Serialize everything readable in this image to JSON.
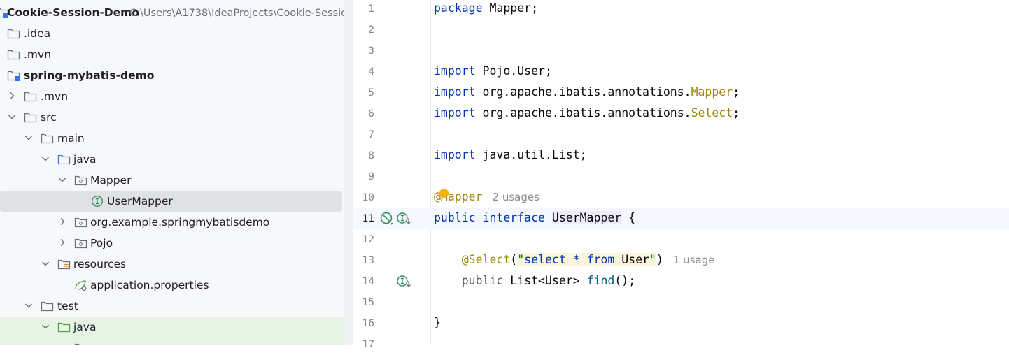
{
  "project_tree": {
    "root": {
      "name": "Cookie-Session-Demo",
      "path": "C:\\Users\\A1738\\IdeaProjects\\Cookie-Sessio"
    },
    "items": [
      {
        "label": "Cookie-Session-Demo",
        "icon": "module-folder-icon"
      },
      {
        "label": ".idea",
        "icon": "folder-icon"
      },
      {
        "label": ".mvn",
        "icon": "folder-icon"
      },
      {
        "label": "spring-mybatis-demo",
        "icon": "module-folder-icon"
      },
      {
        "label": ".mvn",
        "icon": "folder-icon"
      },
      {
        "label": "src",
        "icon": "folder-icon"
      },
      {
        "label": "main",
        "icon": "folder-icon"
      },
      {
        "label": "java",
        "icon": "source-folder-icon"
      },
      {
        "label": "Mapper",
        "icon": "package-icon"
      },
      {
        "label": "UserMapper",
        "icon": "interface-icon"
      },
      {
        "label": "org.example.springmybatisdemo",
        "icon": "package-icon"
      },
      {
        "label": "Pojo",
        "icon": "package-icon"
      },
      {
        "label": "resources",
        "icon": "resources-folder-icon"
      },
      {
        "label": "application.properties",
        "icon": "spring-properties-icon"
      },
      {
        "label": "test",
        "icon": "folder-icon"
      },
      {
        "label": "java",
        "icon": "test-source-folder-icon"
      }
    ]
  },
  "editor": {
    "lines": [
      {
        "num": "1"
      },
      {
        "num": "2"
      },
      {
        "num": "3"
      },
      {
        "num": "4"
      },
      {
        "num": "5"
      },
      {
        "num": "6"
      },
      {
        "num": "7"
      },
      {
        "num": "8"
      },
      {
        "num": "9"
      },
      {
        "num": "10"
      },
      {
        "num": "11"
      },
      {
        "num": "12"
      },
      {
        "num": "13"
      },
      {
        "num": "14"
      },
      {
        "num": "15"
      },
      {
        "num": "16"
      },
      {
        "num": "17"
      }
    ],
    "code": {
      "l1": {
        "kw": "package",
        "rest": " Mapper;"
      },
      "l4": {
        "kw": "import",
        "rest": " Pojo.User;"
      },
      "l5": {
        "kw": "import",
        "pre": " org.apache.ibatis.annotations.",
        "ann": "Mapper",
        "post": ";"
      },
      "l6": {
        "kw": "import",
        "pre": " org.apache.ibatis.annotations.",
        "ann": "Select",
        "post": ";"
      },
      "l8": {
        "kw": "import",
        "rest": " java.util.List;"
      },
      "l10": {
        "ann": "@Mapper",
        "hint": "2 usages"
      },
      "l11": {
        "kw1": "public",
        "kw2": "interface",
        "name": "UserMapper",
        "post": " {"
      },
      "l13": {
        "indent": "    ",
        "ann": "@Select",
        "open": "(",
        "q1": "\"",
        "s1": "select * ",
        "skw": "from",
        "s2": " User",
        "q2": "\"",
        "close": ")",
        "hint": "1 usage"
      },
      "l14": {
        "indent": "    ",
        "kw": "public",
        "mid": " List<User> ",
        "method": "find",
        "post": "();"
      },
      "l16": {
        "text": "}"
      }
    }
  },
  "colors": {
    "keyword": "#0033b3",
    "annotation": "#9e880d",
    "string": "#067d17",
    "selection": "#dfe1e5",
    "test_folder_bg": "#e6f4e3",
    "interface_icon": "#2e8b57"
  }
}
